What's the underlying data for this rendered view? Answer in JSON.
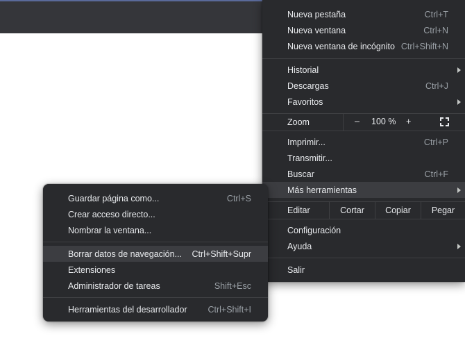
{
  "main_menu": {
    "items": [
      {
        "label": "Nueva pestaña",
        "shortcut": "Ctrl+T"
      },
      {
        "label": "Nueva ventana",
        "shortcut": "Ctrl+N"
      },
      {
        "label": "Nueva ventana de incógnito",
        "shortcut": "Ctrl+Shift+N"
      },
      {
        "label": "Historial"
      },
      {
        "label": "Descargas",
        "shortcut": "Ctrl+J"
      },
      {
        "label": "Favoritos"
      },
      {
        "label": "Imprimir...",
        "shortcut": "Ctrl+P"
      },
      {
        "label": "Transmitir..."
      },
      {
        "label": "Buscar",
        "shortcut": "Ctrl+F"
      },
      {
        "label": "Más herramientas"
      },
      {
        "label": "Configuración"
      },
      {
        "label": "Ayuda"
      },
      {
        "label": "Salir"
      }
    ],
    "zoom": {
      "label": "Zoom",
      "minus": "–",
      "level": "100 %",
      "plus": "+",
      "fullscreen_icon": "fullscreen-icon"
    },
    "edit": {
      "label": "Editar",
      "cut": "Cortar",
      "copy": "Copiar",
      "paste": "Pegar"
    }
  },
  "sub_menu": {
    "items": [
      {
        "label": "Guardar página como...",
        "shortcut": "Ctrl+S"
      },
      {
        "label": "Crear acceso directo..."
      },
      {
        "label": "Nombrar la ventana..."
      },
      {
        "label": "Borrar datos de navegación...",
        "shortcut": "Ctrl+Shift+Supr"
      },
      {
        "label": "Extensiones"
      },
      {
        "label": "Administrador de tareas",
        "shortcut": "Shift+Esc"
      },
      {
        "label": "Herramientas del desarrollador",
        "shortcut": "Ctrl+Shift+I"
      }
    ]
  },
  "colors": {
    "menu_bg": "#292a2d",
    "highlight": "#3c3d41",
    "topbar": "#35363a"
  }
}
